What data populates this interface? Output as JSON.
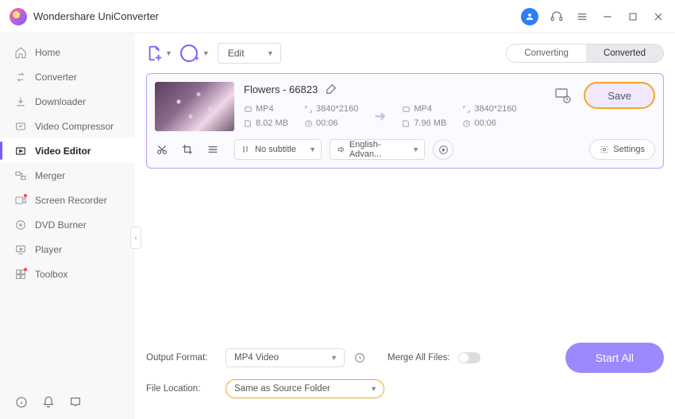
{
  "app": {
    "title": "Wondershare UniConverter"
  },
  "sidebar": {
    "items": [
      {
        "label": "Home"
      },
      {
        "label": "Converter"
      },
      {
        "label": "Downloader"
      },
      {
        "label": "Video Compressor"
      },
      {
        "label": "Video Editor"
      },
      {
        "label": "Merger"
      },
      {
        "label": "Screen Recorder"
      },
      {
        "label": "DVD Burner"
      },
      {
        "label": "Player"
      },
      {
        "label": "Toolbox"
      }
    ]
  },
  "toolbar": {
    "edit_label": "Edit",
    "tab_converting": "Converting",
    "tab_converted": "Converted"
  },
  "file": {
    "name": "Flowers - 66823",
    "src": {
      "format": "MP4",
      "resolution": "3840*2160",
      "size": "8.02 MB",
      "duration": "00:06"
    },
    "dst": {
      "format": "MP4",
      "resolution": "3840*2160",
      "size": "7.96 MB",
      "duration": "00:06"
    },
    "save_label": "Save",
    "subtitle": "No subtitle",
    "audio": "English-Advan...",
    "settings_label": "Settings"
  },
  "footer": {
    "output_format_label": "Output Format:",
    "output_format_value": "MP4 Video",
    "file_location_label": "File Location:",
    "file_location_value": "Same as Source Folder",
    "merge_label": "Merge All Files:",
    "start_label": "Start All"
  }
}
